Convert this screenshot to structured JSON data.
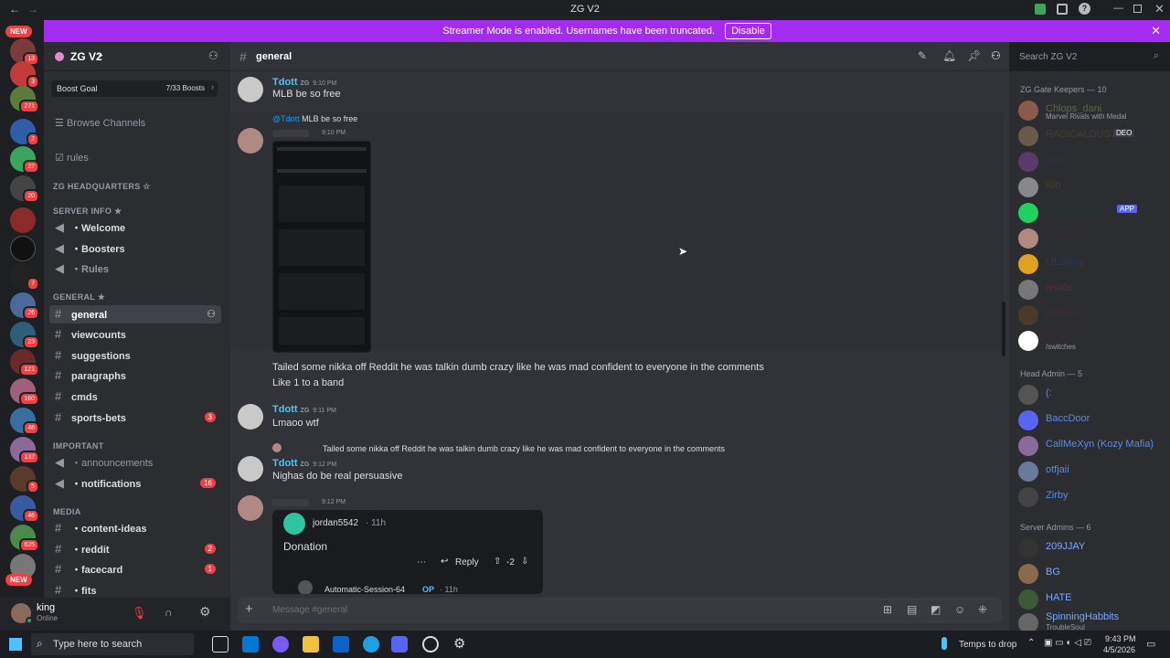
{
  "window": {
    "title": "ZG V2"
  },
  "banner": {
    "text": "Streamer Mode is enabled. Usernames have been truncated.",
    "disable_label": "Disable"
  },
  "servers": {
    "new_label": "NEW",
    "badges": [
      "13",
      "3",
      "271",
      "2",
      "22",
      "20",
      "7",
      "26",
      "23",
      "121",
      "160",
      "48",
      "132",
      "5",
      "46",
      "625"
    ]
  },
  "guild": {
    "name": "ZG V2",
    "boost": {
      "label": "Boost Goal",
      "progress": "7/33 Boosts"
    },
    "browse": "Browse Channels",
    "rules": "rules",
    "categories": {
      "hq": "ZG HEADQUARTERS ☆",
      "server_info": "SERVER INFO ★",
      "general": "GENERAL ★",
      "important": "IMPORTANT",
      "media": "MEDIA"
    },
    "channels": [
      {
        "name": "・Welcome"
      },
      {
        "name": "・Boosters"
      },
      {
        "name": "・Rules"
      },
      {
        "name": "general"
      },
      {
        "name": "viewcounts"
      },
      {
        "name": "suggestions"
      },
      {
        "name": "paragraphs"
      },
      {
        "name": "cmds"
      },
      {
        "name": "sports-bets",
        "badge": "3"
      },
      {
        "name": "・announcements"
      },
      {
        "name": "・notifications",
        "badge": "16"
      },
      {
        "name": "・content-ideas"
      },
      {
        "name": "・reddit",
        "badge": "2"
      },
      {
        "name": "・facecard",
        "badge": "1"
      },
      {
        "name": "・fits"
      }
    ]
  },
  "user": {
    "name": "king",
    "status": "Online"
  },
  "header": {
    "channel": "general",
    "search_placeholder": "Search ZG V2"
  },
  "messages": {
    "m1": {
      "author": "Tdott",
      "tag": "ZG",
      "time": "9:10 PM",
      "text": "MLB be so free"
    },
    "m2": {
      "reply_to": "@Tdott",
      "reply_text": "MLB be so free",
      "time": "9:10 PM",
      "text1": "Tailed some nikka off Reddit he was talkin dumb crazy like he was mad confident to everyone in the comments",
      "text2": "Like 1 to a band"
    },
    "m3": {
      "author": "Tdott",
      "tag": "ZG",
      "time": "9:11 PM",
      "text": "Lmaoo wtf"
    },
    "m4": {
      "reply_text": "Tailed some nikka off Reddit he was talkin dumb crazy like he was mad confident to everyone in the comments",
      "author": "Tdott",
      "tag": "ZG",
      "time": "9:12 PM",
      "text": "Nighas do be real persuasive"
    },
    "m5": {
      "time": "9:12 PM",
      "embed": {
        "user": "jordan5542",
        "ago": "· 11h",
        "body": "Donation",
        "reply_label": "Reply",
        "votes": "-2",
        "sub_user": "Automatic-Session-64",
        "sub_op": "OP",
        "sub_ago": "· 11h"
      }
    }
  },
  "composer": {
    "placeholder": "Message #general"
  },
  "members": {
    "sections": [
      "ZG Gate Keepers — 10",
      "Head Admin — 5",
      "Server Admins — 6"
    ],
    "gatekeepers": [
      {
        "name": "Chlops_dani",
        "status": "Marvel Rivals with Medal"
      },
      {
        "name": "RADICALDUST",
        "badge": "DEO"
      },
      {
        "name": "ilent"
      },
      {
        "name": "kilo"
      },
      {
        "name": "Jack Revers",
        "badge": "APP"
      },
      {
        "name": "lovesmp"
      },
      {
        "name": "LILSlimy"
      },
      {
        "name": "rejabs"
      },
      {
        "name": "Ruined"
      },
      {
        "name": "Slaughr",
        "status": "/switches"
      }
    ],
    "head_admins": [
      {
        "name": "(:"
      },
      {
        "name": "BaccDoor"
      },
      {
        "name": "CallMeXyn (Kozy Mafia)"
      },
      {
        "name": "otfjaii"
      },
      {
        "name": "Zirby"
      }
    ],
    "server_admins": [
      {
        "name": "209JJAY"
      },
      {
        "name": "BG"
      },
      {
        "name": "HATE"
      },
      {
        "name": "SpinningHabbits",
        "status": "TroubleSoul"
      }
    ]
  },
  "taskbar": {
    "search_placeholder": "Type here to search",
    "weather": "Temps to drop",
    "time": "9:43 PM",
    "date": "4/5/2026"
  },
  "colors": {
    "accent": "#5865f2",
    "banner": "#a32cf0",
    "badge": "#f23f43",
    "name_blue": "#4fc3f7"
  }
}
